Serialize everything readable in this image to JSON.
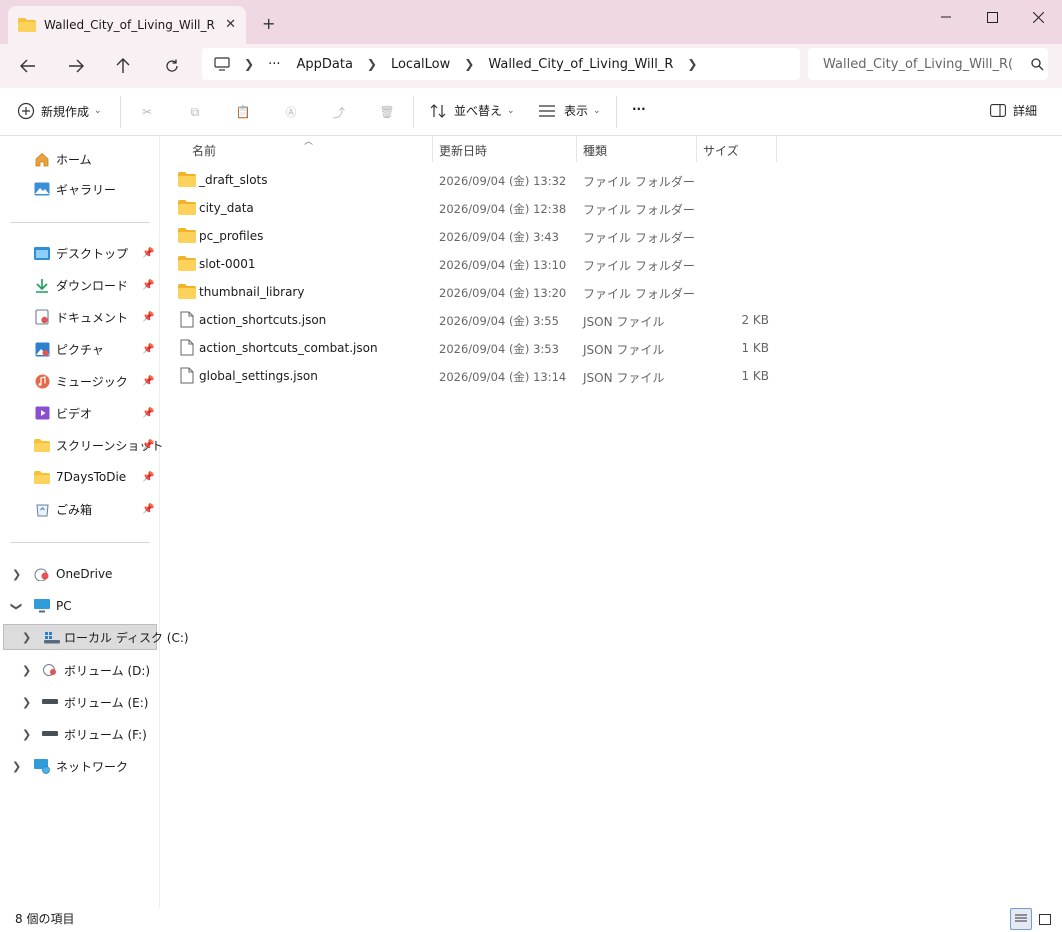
{
  "tab": {
    "title": "Walled_City_of_Living_Will_R",
    "close": "✕",
    "new": "+"
  },
  "window": {
    "minimize": "—",
    "maximize": "☐",
    "close": "✕"
  },
  "breadcrumb": {
    "ellipsis": "···",
    "items": [
      "AppData",
      "LocalLow",
      "Walled_City_of_Living_Will_R"
    ]
  },
  "search": {
    "value": "Walled_City_of_Living_Will_R("
  },
  "toolbar": {
    "new_label": "新規作成",
    "sort_label": "並べ替え",
    "view_label": "表示",
    "more": "···",
    "details_label": "詳細"
  },
  "sidebar": {
    "quick": [
      {
        "label": "ホーム",
        "icon": "home-icon"
      },
      {
        "label": "ギャラリー",
        "icon": "gallery-icon"
      }
    ],
    "pinned": [
      {
        "label": "デスクトップ",
        "icon": "desktop-icon"
      },
      {
        "label": "ダウンロード",
        "icon": "download-icon"
      },
      {
        "label": "ドキュメント",
        "icon": "documents-icon"
      },
      {
        "label": "ピクチャ",
        "icon": "pictures-icon"
      },
      {
        "label": "ミュージック",
        "icon": "music-icon"
      },
      {
        "label": "ビデオ",
        "icon": "video-icon"
      },
      {
        "label": "スクリーンショット",
        "icon": "folder-icon"
      },
      {
        "label": "7DaysToDie",
        "icon": "folder-icon"
      },
      {
        "label": "ごみ箱",
        "icon": "recycle-bin-icon"
      }
    ],
    "tree": [
      {
        "label": "OneDrive",
        "icon": "onedrive-icon"
      },
      {
        "label": "PC",
        "icon": "pc-icon"
      },
      {
        "label": "ローカル ディスク (C:)",
        "icon": "drive-icon"
      },
      {
        "label": "ボリューム (D:)",
        "icon": "drive-icon"
      },
      {
        "label": "ボリューム (E:)",
        "icon": "drive-icon"
      },
      {
        "label": "ボリューム (F:)",
        "icon": "drive-icon"
      },
      {
        "label": "ネットワーク",
        "icon": "network-icon"
      }
    ]
  },
  "columns": {
    "name": "名前",
    "date": "更新日時",
    "type": "種類",
    "size": "サイズ"
  },
  "files": [
    {
      "name": "_draft_slots",
      "date": "2026/09/04 (金) 13:32",
      "type": "ファイル フォルダー",
      "size": "",
      "icon": "folder-icon"
    },
    {
      "name": "city_data",
      "date": "2026/09/04 (金) 12:38",
      "type": "ファイル フォルダー",
      "size": "",
      "icon": "folder-icon"
    },
    {
      "name": "pc_profiles",
      "date": "2026/09/04 (金) 3:43",
      "type": "ファイル フォルダー",
      "size": "",
      "icon": "folder-icon"
    },
    {
      "name": "slot-0001",
      "date": "2026/09/04 (金) 13:10",
      "type": "ファイル フォルダー",
      "size": "",
      "icon": "folder-icon"
    },
    {
      "name": "thumbnail_library",
      "date": "2026/09/04 (金) 13:20",
      "type": "ファイル フォルダー",
      "size": "",
      "icon": "folder-icon"
    },
    {
      "name": "action_shortcuts.json",
      "date": "2026/09/04 (金) 3:55",
      "type": "JSON ファイル",
      "size": "2 KB",
      "icon": "file-icon"
    },
    {
      "name": "action_shortcuts_combat.json",
      "date": "2026/09/04 (金) 3:53",
      "type": "JSON ファイル",
      "size": "1 KB",
      "icon": "file-icon"
    },
    {
      "name": "global_settings.json",
      "date": "2026/09/04 (金) 13:14",
      "type": "JSON ファイル",
      "size": "1 KB",
      "icon": "file-icon"
    }
  ],
  "status": {
    "count": "8 個の項目"
  },
  "colors": {
    "titlebar": "#efd7e3",
    "navbar": "#f9f0f4",
    "folder": "#f5c13b",
    "selected": "#dcdcdc"
  }
}
